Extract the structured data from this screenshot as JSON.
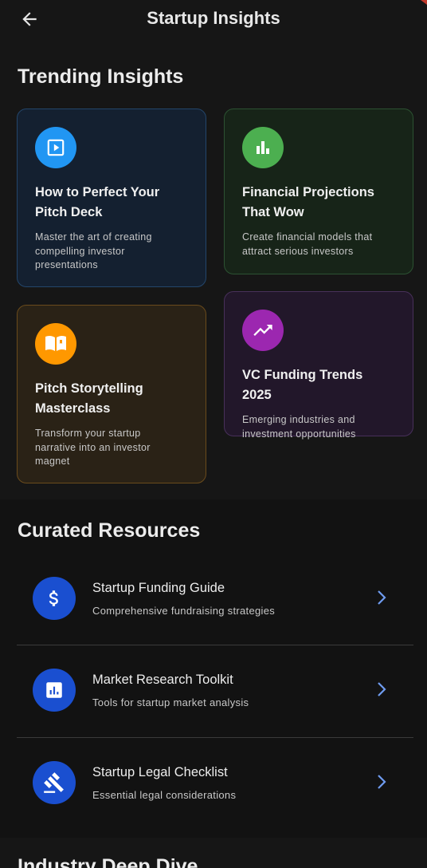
{
  "appbar": {
    "title": "Startup Insights",
    "back_icon": "arrow-left-icon"
  },
  "trending": {
    "heading": "Trending Insights",
    "cards": [
      {
        "title_line1": "How to Perfect Your",
        "title_line2": "Pitch Deck",
        "desc_line1": "Master the art of creating",
        "desc_line2": "compelling investor",
        "desc_line3": "presentations",
        "icon": "play-icon",
        "color": "#2196f3"
      },
      {
        "title_line1": "Financial Projections",
        "title_line2": "That Wow",
        "desc_line1": "Create financial models that",
        "desc_line2": "attract serious investors",
        "icon": "bar-chart-icon",
        "color": "#4caf50"
      },
      {
        "title_line1": "Pitch Storytelling",
        "title_line2": "Masterclass",
        "desc_line1": "Transform your startup",
        "desc_line2": "narrative into an investor",
        "desc_line3": "magnet",
        "icon": "book-icon",
        "color": "#ff9800"
      },
      {
        "title_line1": "VC Funding Trends 2025",
        "desc_line1": "Emerging industries and",
        "desc_line2": "investment opportunities",
        "icon": "trending-up-icon",
        "color": "#9c27b0"
      }
    ]
  },
  "resources": {
    "heading": "Curated Resources",
    "items": [
      {
        "title": "Startup Funding Guide",
        "subtitle": "Comprehensive fundraising strategies",
        "icon": "dollar-icon"
      },
      {
        "title": "Market Research Toolkit",
        "subtitle": "Tools for startup market analysis",
        "icon": "analytics-icon"
      },
      {
        "title": "Startup Legal Checklist",
        "subtitle": "Essential legal considerations",
        "icon": "gavel-icon"
      }
    ],
    "accent": "#1a4fd0",
    "chevron_color": "#6f9cf0"
  },
  "industry": {
    "heading": "Industry Deep Dive"
  }
}
